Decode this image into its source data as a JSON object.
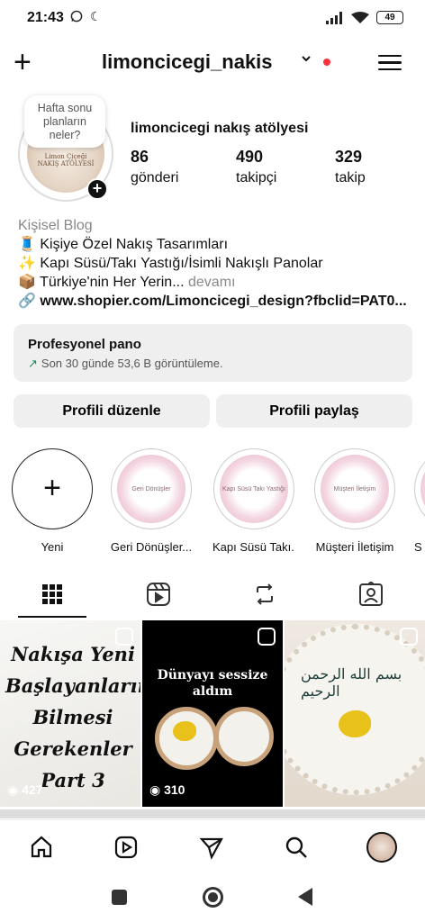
{
  "status": {
    "time": "21:43",
    "battery": "49"
  },
  "header": {
    "username": "limoncicegi_nakis"
  },
  "note": {
    "text": "Hafta sonu planların neler?"
  },
  "avatar": {
    "caption": "Limon Çiçeği NAKIŞ ATÖLYESİ"
  },
  "profile": {
    "display_name": "limoncicegi nakış atölyesi"
  },
  "stats": [
    {
      "value": "86",
      "label": "gönderi"
    },
    {
      "value": "490",
      "label": "takipçi"
    },
    {
      "value": "329",
      "label": "takip"
    }
  ],
  "bio": {
    "category": "Kişisel Blog",
    "line1": "🧵 Kişiye Özel Nakış Tasarımları",
    "line2": "✨ Kapı Süsü/Takı Yastığı/İsimli Nakışlı Panolar",
    "line3": "📦 Türkiye'nin Her Yerin...",
    "more": " devamı",
    "link": "www.shopier.com/Limoncicegi_design?fbclid=PAT0..."
  },
  "pro_panel": {
    "title": "Profesyonel pano",
    "subtitle": "Son 30 günde 53,6 B görüntüleme."
  },
  "buttons": {
    "edit": "Profili düzenle",
    "share": "Profili paylaş"
  },
  "highlights": [
    {
      "label": "Yeni",
      "cover": ""
    },
    {
      "label": "Geri Dönüşler...",
      "cover": "Geri Dönüşler"
    },
    {
      "label": "Kapı Süsü Takı...",
      "cover": "Kapı Süsü Takı Yastığı"
    },
    {
      "label": "Müşteri İletişim",
      "cover": "Müşteri İletişim"
    },
    {
      "label": "S",
      "cover": ""
    }
  ],
  "posts": [
    {
      "overlay_text": "Nakışa Yeni Başlayanların Bilmesi Gerekenler Part 3",
      "views": "427"
    },
    {
      "overlay_text": "Dünyayı sessize aldım",
      "views": "310"
    },
    {
      "overlay_text": "بسم الله الرحمن الرحيم",
      "views": ""
    }
  ],
  "icons": {
    "new_post": "plus-icon",
    "menu": "hamburger-icon",
    "tab_grid": "grid-icon",
    "tab_reels": "reels-icon",
    "tab_reposts": "repost-icon",
    "tab_tagged": "tagged-icon",
    "nav_home": "home-icon",
    "nav_reels": "reels-icon",
    "nav_send": "send-icon",
    "nav_search": "search-icon"
  }
}
